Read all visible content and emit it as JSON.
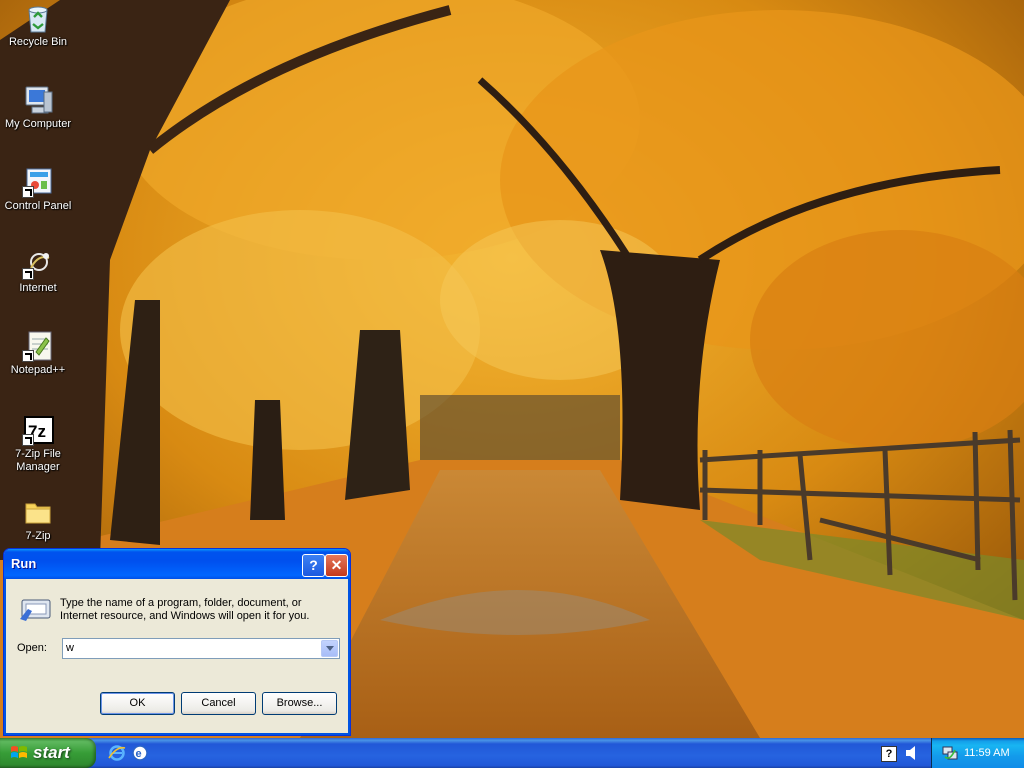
{
  "desktop": {
    "icons": [
      {
        "label": "Recycle Bin",
        "icon": "recycle-bin-icon"
      },
      {
        "label": "My Computer",
        "icon": "my-computer-icon"
      },
      {
        "label": "Control Panel",
        "icon": "control-panel-icon"
      },
      {
        "label": "Internet",
        "icon": "internet-icon"
      },
      {
        "label": "Notepad++",
        "icon": "notepad-plus-plus-icon"
      },
      {
        "label": "7-Zip File Manager",
        "icon": "seven-zip-icon"
      },
      {
        "label": "7-Zip",
        "icon": "folder-icon"
      }
    ]
  },
  "run_dialog": {
    "title": "Run",
    "help_button": "?",
    "close_button": "✕",
    "description": "Type the name of a program, folder, document, or Internet resource, and Windows will open it for you.",
    "open_label": "Open:",
    "open_value": "w",
    "ok_label": "OK",
    "cancel_label": "Cancel",
    "browse_label": "Browse..."
  },
  "taskbar": {
    "start_label": "start",
    "quick_launch": [
      "internet-explorer-icon",
      "ie-alt-icon"
    ],
    "tray_help": "?",
    "clock": "11:59 AM"
  },
  "colors": {
    "titlebar": "#0054e3",
    "taskbar": "#245edb",
    "start_green": "#3c963c",
    "tray_blue": "#139ee9",
    "dialog_face": "#ece9d8"
  }
}
